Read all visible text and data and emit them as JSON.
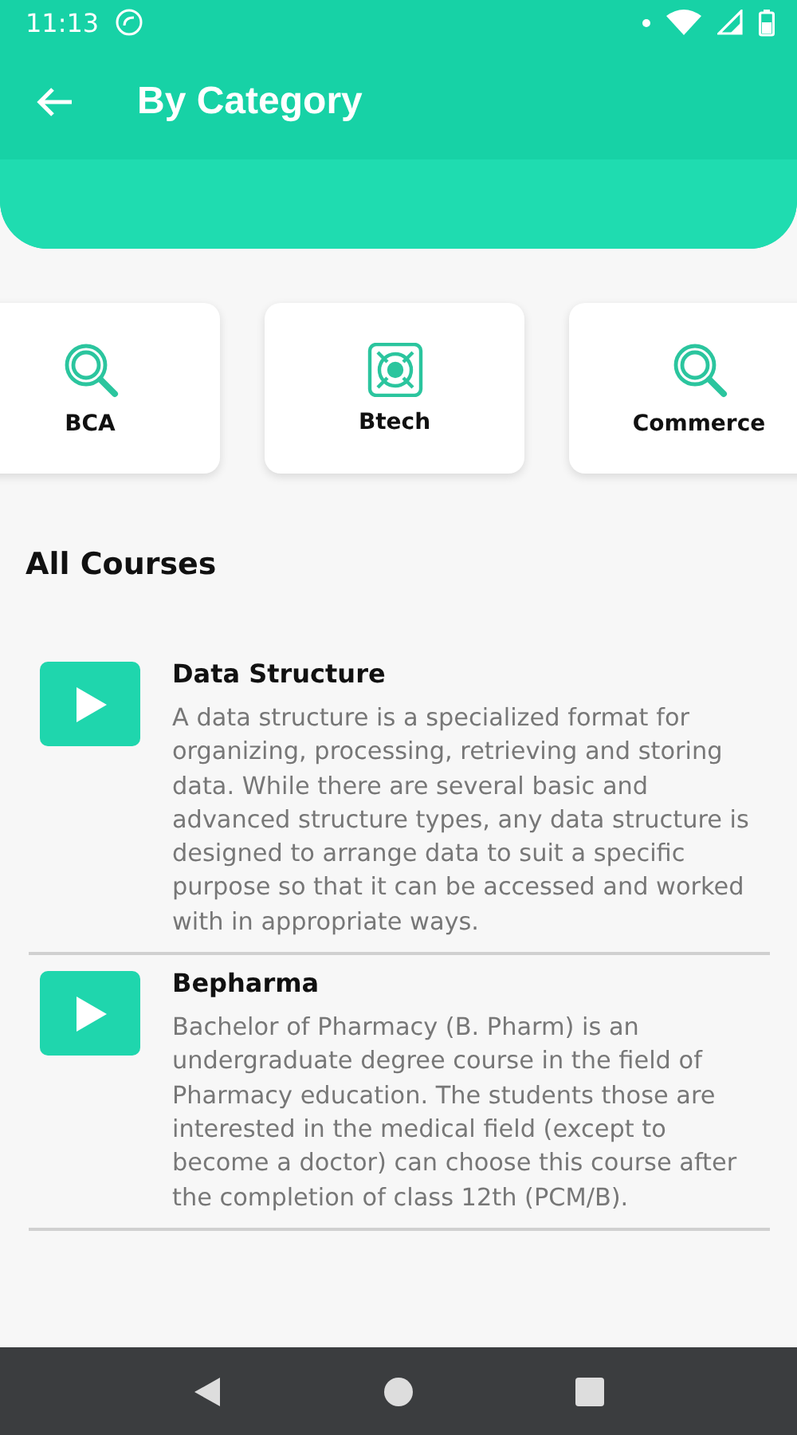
{
  "status_bar": {
    "time": "11:13"
  },
  "app_bar": {
    "title": "By Category"
  },
  "categories": [
    {
      "label": "BCA"
    },
    {
      "label": "Btech"
    },
    {
      "label": "Commerce"
    }
  ],
  "section_title": "All Courses",
  "courses": [
    {
      "title": "Data Structure",
      "description": "A data structure is a specialized format for organizing, processing, retrieving and storing data. While there are several basic and advanced structure types, any data structure is designed to arrange data to suit a specific purpose so that it can be accessed and worked with in appropriate ways."
    },
    {
      "title": "Bepharma",
      "description": "Bachelor of Pharmacy (B. Pharm) is an undergraduate degree course in the field of Pharmacy education. The students those are interested in the medical field (except to become a doctor) can choose this course after the completion of class 12th (PCM/B)."
    }
  ]
}
